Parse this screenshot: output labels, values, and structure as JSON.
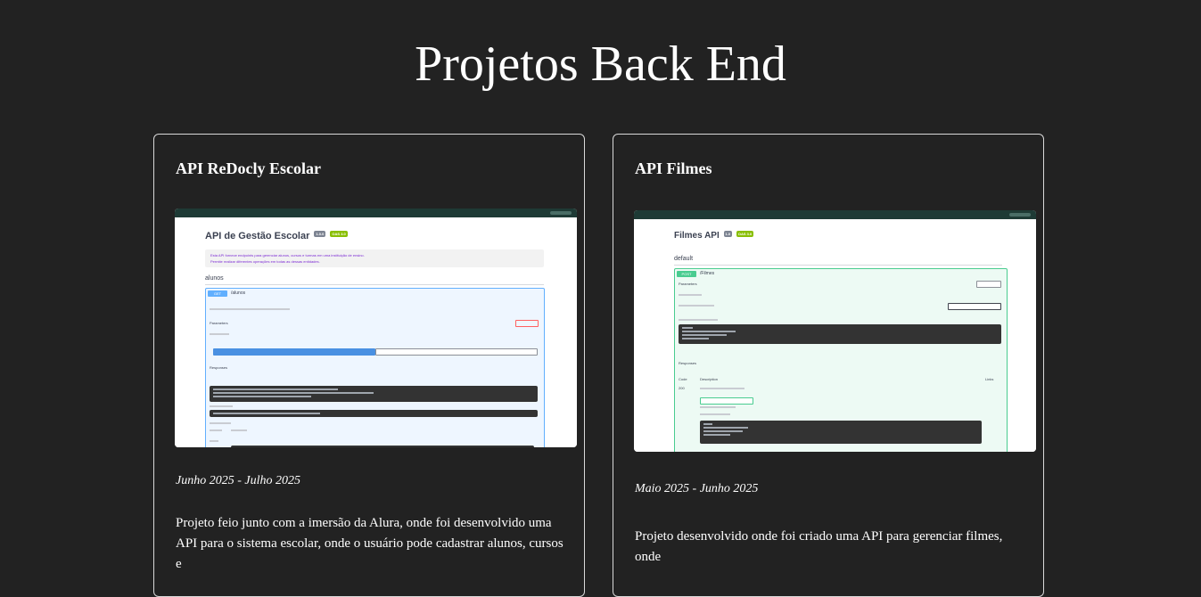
{
  "page": {
    "title": "Projetos Back End"
  },
  "projects": [
    {
      "title": "API ReDocly Escolar",
      "date": "Junho 2025 - Julho 2025",
      "description": "Projeto feio junto com a imersão da Alura, onde foi desenvolvido uma API para o sistema escolar, onde o usuário pode cadastrar alunos, cursos e",
      "screenshot": {
        "doc_title": "API de Gestão Escolar",
        "version_badge": "1.0.0",
        "oas_badge": "OAS 3.0",
        "intro_line_1": "Esta API fornece endpoints para gerenciar alunos, cursos e turmas em uma instituição de ensino.",
        "intro_line_2": "Permite realizar diferentes operações em todas as dessas entidades.",
        "tag": "alunos",
        "method": "GET",
        "path": "/alunos",
        "execute_label": "Execute",
        "clear_label": "Clear",
        "cancel_label": "Cancel",
        "parameters_label": "Parameters",
        "responses_label": "Responses"
      }
    },
    {
      "title": "API Filmes",
      "date": "Maio 2025 - Junho 2025",
      "description": "Projeto desenvolvido onde foi criado uma API para gerenciar filmes, onde",
      "screenshot": {
        "doc_title": "Filmes API",
        "version_badge": "1.0",
        "oas_badge": "OAS 3.0",
        "tag": "default",
        "method": "POST",
        "path": "/Filmes",
        "parameters_label": "Parameters",
        "try_label": "Try it out",
        "responses_label": "Responses",
        "code_label": "Code",
        "description_label": "Description",
        "links_label": "Links",
        "status_code": "200"
      }
    }
  ]
}
